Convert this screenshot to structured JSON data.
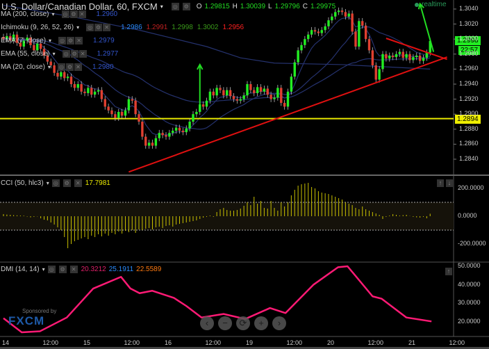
{
  "header": {
    "title": "U.S. Dollar/Canadian Dollar, 60, FXCM",
    "o_label": "O",
    "o": "1.29815",
    "h_label": "H",
    "h": "1.30039",
    "l_label": "L",
    "l": "1.29796",
    "c_label": "C",
    "c": "1.29975",
    "realtime": "realtime"
  },
  "indicators": [
    {
      "label": "MA (200, close)",
      "values": [
        "1.2960"
      ],
      "colors": [
        "#3355cc"
      ]
    },
    {
      "label": "Ichimoku (9, 26, 52, 26)",
      "values": [
        "1.2986",
        "1.2991",
        "1.2998",
        "1.3002",
        "1.2956"
      ],
      "colors": [
        "#2a8cff",
        "#c02020",
        "#3a9a1a",
        "#3a9a1a",
        "#ff2020"
      ]
    },
    {
      "label": "EMA (7, close)",
      "values": [
        "1.2979"
      ],
      "colors": [
        "#3355cc"
      ]
    },
    {
      "label": "EMA (55, close)",
      "values": [
        "1.2977"
      ],
      "colors": [
        "#3355cc"
      ]
    },
    {
      "label": "MA (20, close)",
      "values": [
        "1.2980"
      ],
      "colors": [
        "#3355cc"
      ]
    }
  ],
  "price_tags": {
    "last": "1.2998",
    "countdown": "22:57",
    "level": "1.2894"
  },
  "cci": {
    "label": "CCI (50, hlc3)",
    "value": "17.7981",
    "axis": [
      "200.0000",
      "0.0000",
      "-200.0000"
    ]
  },
  "dmi": {
    "label": "DMI (14, 14)",
    "values": [
      "20.3212",
      "25.1911",
      "22.5589"
    ],
    "axis": [
      "50.0000",
      "40.0000",
      "30.0000",
      "20.0000"
    ]
  },
  "sponsor": {
    "text": "Sponsored by",
    "brand": "FXCM"
  },
  "nav": {
    "prev": "‹",
    "zoom_out": "−",
    "reset": "⟳",
    "zoom_in": "+",
    "next": "›"
  },
  "chart_data": [
    {
      "type": "candlestick",
      "title": "U.S. Dollar/Canadian Dollar, 60, FXCM",
      "interval": "60",
      "x_ticks": [
        {
          "label": "14",
          "bar": 0
        },
        {
          "label": "12:00",
          "bar": 12
        },
        {
          "label": "15",
          "bar": 24
        },
        {
          "label": "12:00",
          "bar": 36
        },
        {
          "label": "16",
          "bar": 48
        },
        {
          "label": "12:00",
          "bar": 60
        },
        {
          "label": "19",
          "bar": 72
        },
        {
          "label": "12:00",
          "bar": 84
        },
        {
          "label": "20",
          "bar": 96
        },
        {
          "label": "12:00",
          "bar": 108
        },
        {
          "label": "21",
          "bar": 120
        },
        {
          "label": "12:00",
          "bar": 132
        }
      ],
      "y_ticks": [
        "1.3040",
        "1.3020",
        "1.3000",
        "1.2980",
        "1.2960",
        "1.2940",
        "1.2920",
        "1.2900",
        "1.2880",
        "1.2860",
        "1.2840"
      ],
      "ylim": [
        1.2828,
        1.3052
      ],
      "closes": [
        1.3,
        1.3004,
        1.2998,
        1.3006,
        1.2995,
        1.299,
        1.2998,
        1.3002,
        1.2992,
        1.2985,
        1.2994,
        1.2987,
        1.2978,
        1.297,
        1.2965,
        1.2955,
        1.295,
        1.2956,
        1.2948,
        1.295,
        1.294,
        1.2935,
        1.294,
        1.293,
        1.2928,
        1.2935,
        1.2926,
        1.293,
        1.2932,
        1.292,
        1.291,
        1.2905,
        1.29,
        1.2895,
        1.2903,
        1.2898,
        1.2905,
        1.292,
        1.2918,
        1.29,
        1.289,
        1.287,
        1.2858,
        1.2862,
        1.2858,
        1.2868,
        1.2875,
        1.2872,
        1.287,
        1.2875,
        1.2878,
        1.2882,
        1.2878,
        1.2876,
        1.2881,
        1.289,
        1.29,
        1.2903,
        1.2913,
        1.291,
        1.2918,
        1.293,
        1.2925,
        1.2935,
        1.2932,
        1.2925,
        1.2932,
        1.2924,
        1.292,
        1.2918,
        1.292,
        1.2925,
        1.294,
        1.2932,
        1.2928,
        1.2936,
        1.293,
        1.2934,
        1.2926,
        1.292,
        1.2922,
        1.2935,
        1.2915,
        1.291,
        1.293,
        1.295,
        1.2969,
        1.2985,
        1.2992,
        1.3,
        1.3006,
        1.3012,
        1.301,
        1.3008,
        1.3012,
        1.3017,
        1.3025,
        1.303,
        1.3036,
        1.3038,
        1.3036,
        1.303,
        1.3034,
        1.301,
        1.299,
        1.3024,
        1.3018,
        1.3,
        1.2985,
        1.2965,
        1.2946,
        1.296,
        1.298,
        1.2974,
        1.2978,
        1.2976,
        1.298,
        1.2983,
        1.2975,
        1.298,
        1.2972,
        1.2976,
        1.2978,
        1.2971,
        1.2975,
        1.2982,
        1.29975
      ],
      "ma200": [
        [
          0,
          1.3045
        ],
        [
          20,
          1.303
        ],
        [
          40,
          1.3012
        ],
        [
          60,
          1.299
        ],
        [
          70,
          1.2975
        ],
        [
          80,
          1.2968
        ],
        [
          100,
          1.2966
        ],
        [
          126,
          1.296
        ]
      ],
      "horizontal_line": {
        "price": 1.2894,
        "color": "#e8e800"
      },
      "trendlines": [
        {
          "from": [
            37,
            1.2823
          ],
          "to": [
            131,
            1.2976
          ],
          "color": "#e01010"
        },
        {
          "from": [
            113,
            1.3001
          ],
          "to": [
            131,
            1.2973
          ],
          "color": "#e01010"
        }
      ],
      "arrows": [
        {
          "from": [
            58,
            1.2913
          ],
          "to": [
            58,
            1.2966
          ],
          "color": "#22dd22"
        },
        {
          "from": [
            127,
            1.2983
          ],
          "to": [
            123,
            1.3047
          ],
          "color": "#22dd22"
        }
      ],
      "colors": {
        "up": "#22ee22",
        "down": "#e04030",
        "ma": "#25326e"
      }
    },
    {
      "type": "bar",
      "name": "CCI (50, hlc3)",
      "ylim": [
        -290,
        290
      ],
      "bands": [
        100,
        -100
      ],
      "values": [
        15,
        12,
        10,
        8,
        6,
        5,
        4,
        -3,
        -8,
        -5,
        -2,
        -15,
        -25,
        -30,
        -45,
        -60,
        -80,
        -100,
        -150,
        -230,
        -200,
        -180,
        -170,
        -160,
        -150,
        -165,
        -140,
        -150,
        -130,
        -145,
        -125,
        -140,
        -120,
        -130,
        -110,
        -125,
        -105,
        -115,
        -100,
        -120,
        -95,
        -100,
        -90,
        -85,
        -95,
        -80,
        -75,
        -85,
        -70,
        -65,
        -75,
        -60,
        -55,
        -50,
        -45,
        -40,
        -35,
        -30,
        -20,
        -10,
        -5,
        5,
        -5,
        30,
        50,
        60,
        45,
        40,
        40,
        45,
        55,
        75,
        100,
        80,
        140,
        90,
        110,
        60,
        55,
        110,
        60,
        40,
        100,
        70,
        100,
        150,
        190,
        220,
        230,
        235,
        240,
        210,
        200,
        180,
        170,
        165,
        160,
        150,
        140,
        130,
        120,
        100,
        90,
        80,
        60,
        50,
        70,
        50,
        40,
        30,
        20,
        10,
        -20,
        -5,
        5,
        15,
        10,
        5,
        8,
        10,
        2,
        -5,
        -8,
        -10,
        -5,
        -15,
        17.7981
      ],
      "y_ticks": [
        "200.0000",
        "0.0000",
        "-200.0000"
      ],
      "color": "#c8c000"
    },
    {
      "type": "line",
      "name": "DMI (14, 14)",
      "ylim": [
        12,
        53
      ],
      "points": [
        [
          0,
          22
        ],
        [
          5.4,
          14.4
        ],
        [
          10.8,
          15
        ],
        [
          18.7,
          22.4
        ],
        [
          26.5,
          38
        ],
        [
          34.7,
          44.3
        ],
        [
          37.5,
          38
        ],
        [
          40.2,
          35.5
        ],
        [
          43.9,
          36.8
        ],
        [
          50.3,
          33
        ],
        [
          54,
          28.6
        ],
        [
          58.5,
          22.4
        ],
        [
          65,
          24.3
        ],
        [
          71.4,
          21.6
        ],
        [
          78.7,
          27.5
        ],
        [
          83.3,
          24.8
        ],
        [
          91.5,
          40
        ],
        [
          98.8,
          49.5
        ],
        [
          101.6,
          50
        ],
        [
          109,
          33.8
        ],
        [
          111.7,
          32.5
        ],
        [
          119,
          22.4
        ],
        [
          126.4,
          20.3
        ]
      ],
      "y_ticks": [
        "50.0000",
        "40.0000",
        "30.0000",
        "20.0000"
      ],
      "color": "#ff1a75"
    }
  ]
}
